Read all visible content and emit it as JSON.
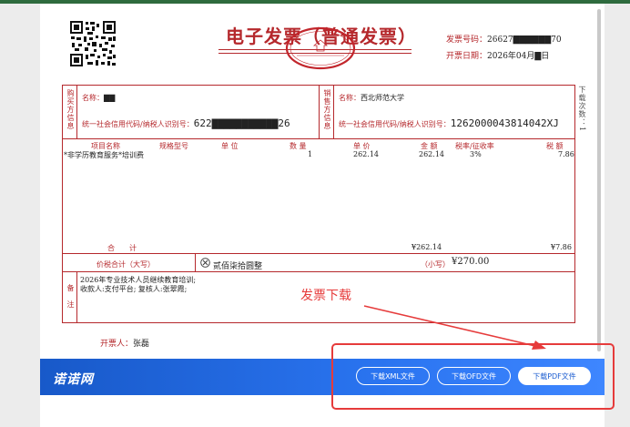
{
  "invoice": {
    "title": "电子发票（普通发票）",
    "number_label": "发票号码：",
    "number_value": "26627▇▇▇▇▇▇70",
    "date_label": "开票日期：",
    "date_value": "2026年04月▇日",
    "seal_text": "全国统一发票监制 国家税务总局 甘肃省税务局",
    "buyer_header": "购买方信息",
    "buyer_name_label": "名称：",
    "buyer_name_value": "▇▇",
    "buyer_tax_label": "统一社会信用代码/纳税人识别号：",
    "buyer_tax_value": "622▇▇▇▇▇▇▇▇▇▇▇26",
    "seller_header": "销售方信息",
    "seller_name_label": "名称：",
    "seller_name_value": "西北师范大学",
    "seller_tax_label": "统一社会信用代码/纳税人识别号：",
    "seller_tax_value": "1262000043814042XJ",
    "columns": [
      "项目名称",
      "规格型号",
      "单 位",
      "数 量",
      "单 价",
      "金 额",
      "税率/征收率",
      "税 额"
    ],
    "items": [
      {
        "name": "*非学历教育服务*培训费",
        "spec": "",
        "unit": "",
        "qty": "1",
        "price": "262.14",
        "amount": "262.14",
        "rate": "3%",
        "tax": "7.86"
      }
    ],
    "total_label": "合　　计",
    "total_amount": "¥262.14",
    "total_tax": "¥7.86",
    "tax_total_label": "价税合计（大写）",
    "tax_total_words": "贰佰柒拾圆整",
    "small_label": "（小写）",
    "small_value": "¥270.00",
    "remark_label": "备注",
    "remark_line1": "2026年专业技术人员继续教育培训;",
    "remark_line2": "收款人:支付平台;  复核人:张翠霞;",
    "drawer_label": "开票人：",
    "drawer_value": "张磊",
    "side_note": "下载次数：1"
  },
  "annotation": {
    "text": "发票下载",
    "color": "#e63b3b"
  },
  "footer": {
    "logo": "诺诺网",
    "buttons": [
      "下载XML文件",
      "下载OFD文件",
      "下载PDF文件"
    ]
  }
}
